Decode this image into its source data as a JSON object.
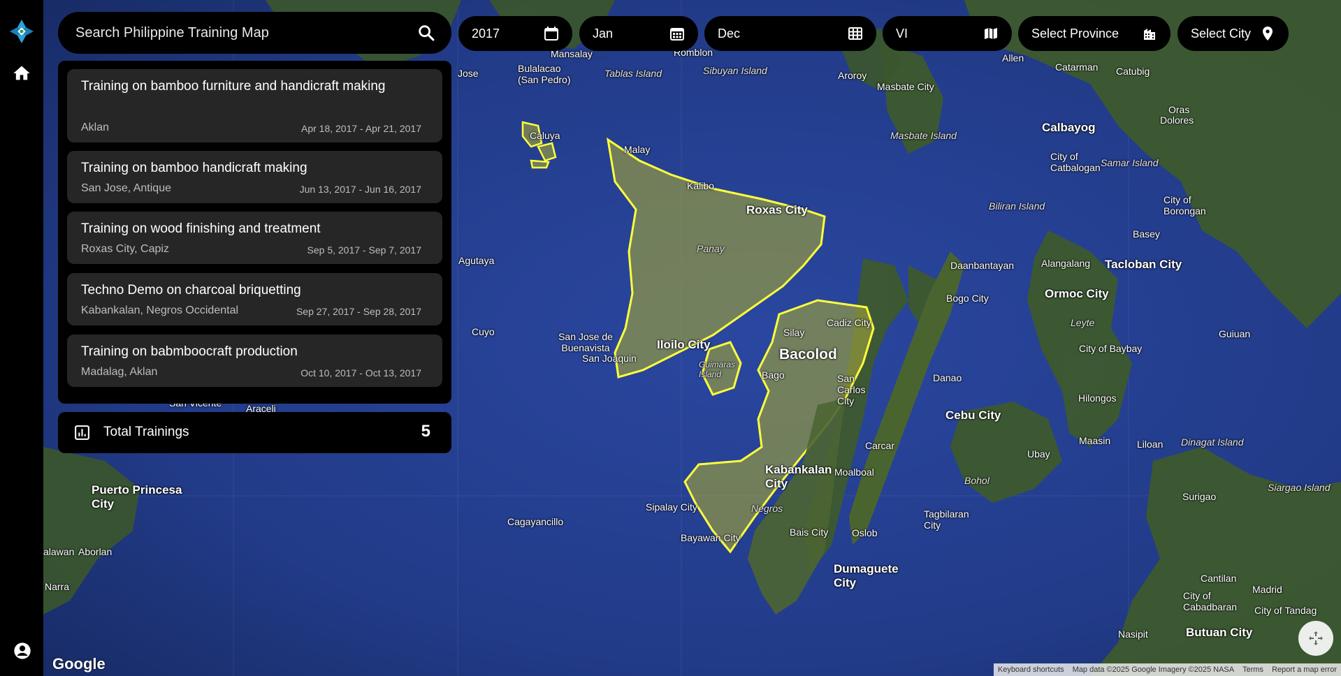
{
  "search": {
    "placeholder": "Search Philippine Training Map"
  },
  "filters": {
    "year": "2017",
    "month_from": "Jan",
    "month_to": "Dec",
    "region": "VI",
    "province": "Select Province",
    "city": "Select City"
  },
  "trainings": [
    {
      "title": "Training on bamboo furniture and handicraft making",
      "place": "Aklan",
      "dates": "Apr 18, 2017 - Apr 21, 2017"
    },
    {
      "title": "Training on bamboo handicraft making",
      "place": "San Jose, Antique",
      "dates": "Jun 13, 2017 - Jun 16, 2017"
    },
    {
      "title": "Training on wood finishing and treatment",
      "place": "Roxas City, Capiz",
      "dates": "Sep 5, 2017 - Sep 7, 2017"
    },
    {
      "title": "Techno Demo on charcoal briquetting",
      "place": "Kabankalan, Negros Occidental",
      "dates": "Sep 27, 2017 - Sep 28, 2017"
    },
    {
      "title": "Training on babmboocraft production",
      "place": "Madalag, Aklan",
      "dates": "Oct 10, 2017 - Oct 13, 2017"
    }
  ],
  "total": {
    "label": "Total Trainings",
    "count": "5"
  },
  "map_labels": {
    "iloilo": "Iloilo City",
    "bacolod": "Bacolod",
    "roxas": "Roxas City",
    "kalibo": "Kalibo",
    "malay": "Malay",
    "panay": "Panay",
    "silay": "Silay",
    "cadiz": "Cadiz City",
    "bago": "Bago",
    "san_carlos": "San Carlos City",
    "kabankalan": "Kabankalan City",
    "negros": "Negros",
    "sipalay": "Sipalay City",
    "bayawan": "Bayawan City",
    "bais": "Bais City",
    "dumaguete": "Dumaguete City",
    "cebu": "Cebu City",
    "bogo": "Bogo City",
    "danao": "Danao",
    "carcar": "Carcar",
    "moalboal": "Moalboal",
    "oslob": "Oslob",
    "ubay": "Ubay",
    "bohol": "Bohol",
    "tagbilaran": "Tagbilaran City",
    "tacloban": "Tacloban City",
    "ormoc": "Ormoc City",
    "leyte": "Leyte",
    "baybay": "City of Baybay",
    "hilongos": "Hilongos",
    "maasin": "Maasin",
    "calbayog": "Calbayog",
    "catbalogan": "City of Catbalogan",
    "samar": "Samar Island",
    "borongan": "City of Borongan",
    "basey": "Basey",
    "guiuan": "Guiuan",
    "masbate_city": "Masbate City",
    "masbate_island": "Masbate Island",
    "aroroy": "Aroroy",
    "biliran": "Biliran Island",
    "daanbantayan": "Daanbantayan",
    "alangalang": "Alangalang",
    "liloan": "Liloan",
    "dinagat": "Dinagat Island",
    "surigao": "Surigao",
    "siargao": "Siargao Island",
    "butuan": "Butuan City",
    "cantilan": "Cantilan",
    "madrid": "Madrid",
    "cabadbaran": "City of Cabadbaran",
    "nasipit": "Nasipit",
    "tandag": "City of Tandag",
    "puerto_princesa": "Puerto Princesa City",
    "aborlan": "Aborlan",
    "narra": "Narra",
    "cagayancillo": "Cagayancillo",
    "cuyo": "Cuyo",
    "agutaya": "Agutaya",
    "san_jose_buenavista": "San Jose de Buenavista",
    "san_joaquin": "San Joaquin",
    "guimaras": "Guimaras Island",
    "caluya": "Caluya",
    "tablas": "Tablas Island",
    "sibuyan": "Sibuyan Island",
    "romblon": "Romblon",
    "bulalacao": "Bulalacao (San Pedro)",
    "mansalay": "Mansalay",
    "san_vicente": "San Vicente",
    "araceli": "Araceli",
    "allen": "Allen",
    "catarman": "Catarman",
    "catubig": "Catubig",
    "oras": "Oras",
    "dolores": "Dolores",
    "jose": "Jose",
    "alawan": "alawan"
  },
  "attribution": {
    "google": "Google",
    "shortcuts": "Keyboard shortcuts",
    "mapdata": "Map data ©2025 Google Imagery ©2025 NASA",
    "terms": "Terms",
    "report": "Report a map error"
  },
  "colors": {
    "highlight": "#ffff3c",
    "panel": "#000000",
    "card": "#262626",
    "ocean": "#1e3478"
  }
}
